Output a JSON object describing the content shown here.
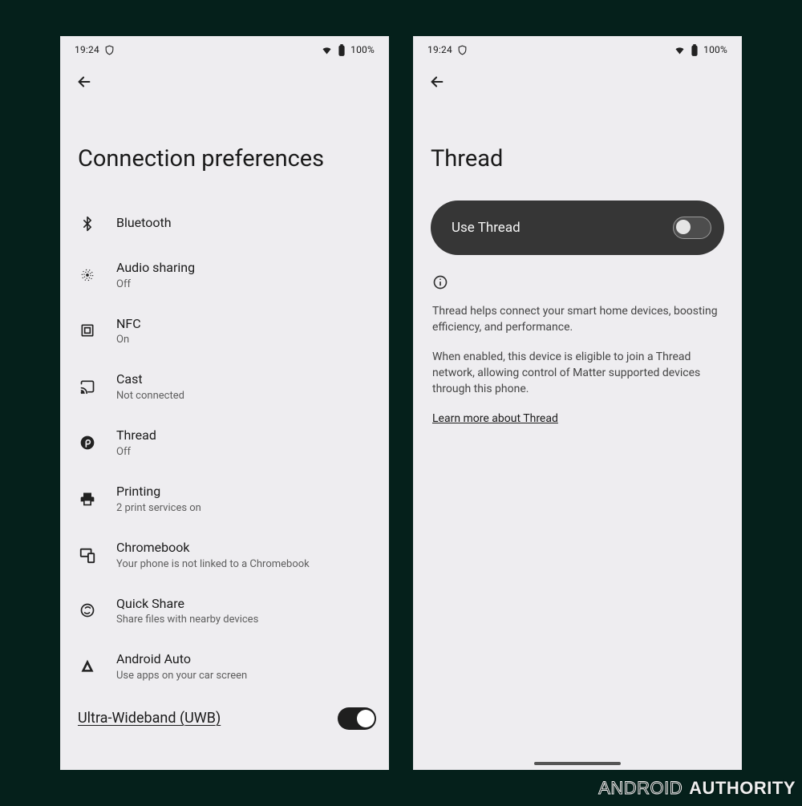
{
  "status": {
    "time": "19:24",
    "battery": "100%"
  },
  "watermark": {
    "a": "ANDROID",
    "b": "AUTHORITY"
  },
  "left": {
    "title": "Connection preferences",
    "items": [
      {
        "icon": "bluetooth",
        "label": "Bluetooth",
        "sub": ""
      },
      {
        "icon": "audioshare",
        "label": "Audio sharing",
        "sub": "Off"
      },
      {
        "icon": "nfc",
        "label": "NFC",
        "sub": "On"
      },
      {
        "icon": "cast",
        "label": "Cast",
        "sub": "Not connected"
      },
      {
        "icon": "thread",
        "label": "Thread",
        "sub": "Off"
      },
      {
        "icon": "print",
        "label": "Printing",
        "sub": "2 print services on"
      },
      {
        "icon": "chromebook",
        "label": "Chromebook",
        "sub": "Your phone is not linked to a Chromebook"
      },
      {
        "icon": "quickshare",
        "label": "Quick Share",
        "sub": "Share files with nearby devices"
      },
      {
        "icon": "androidauto",
        "label": "Android Auto",
        "sub": "Use apps on your car screen"
      }
    ],
    "uwb": {
      "label": "Ultra-Wideband (UWB)"
    }
  },
  "right": {
    "title": "Thread",
    "toggle_label": "Use Thread",
    "info1": "Thread helps connect your smart home devices, boosting efficiency, and performance.",
    "info2": "When enabled, this device is eligible to join a Thread network, allowing control of Matter supported devices through this phone.",
    "link": "Learn more about Thread"
  }
}
